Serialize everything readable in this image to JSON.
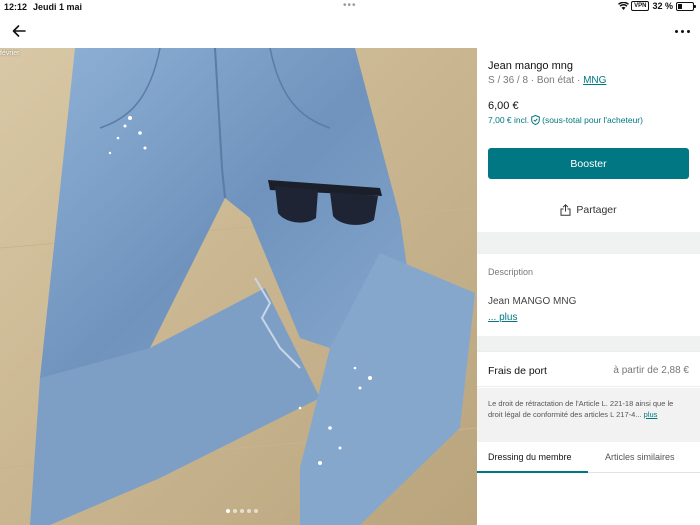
{
  "status_bar": {
    "time": "12:12",
    "date": "Jeudi 1 mai",
    "vpn": "VPN",
    "battery": "32 %",
    "battery_level": 0.32
  },
  "photo": {
    "date_label": "février",
    "pager_count": 5,
    "pager_active": 1
  },
  "item": {
    "title": "Jean mango mng",
    "attributes": "S / 36 / 8 · Bon état · ",
    "brand": "MNG",
    "price": "6,00 €",
    "price_incl": "7,00 € incl.",
    "price_incl_note": "(sous-total pour l'acheteur)"
  },
  "actions": {
    "booster": "Booster",
    "share": "Partager"
  },
  "description": {
    "heading": "Description",
    "text": "Jean MANGO MNG",
    "more": "... plus"
  },
  "shipping": {
    "label": "Frais de port",
    "value": "à partir de 2,88 €"
  },
  "legal": {
    "text": "Le droit de rétractation de l'Article L. 221-18 ainsi que le droit légal de conformité des articles L 217-4...",
    "more": "plus"
  },
  "tabs": {
    "dressing": "Dressing du membre",
    "similar": "Articles similaires"
  },
  "colors": {
    "accent": "#007782",
    "separator": "#f0f1f1"
  }
}
